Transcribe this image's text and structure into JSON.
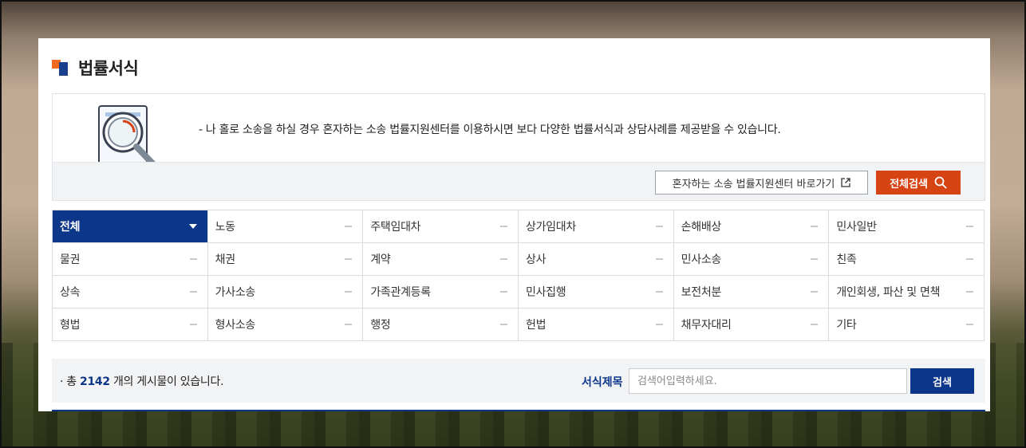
{
  "page": {
    "title": "법률서식"
  },
  "info": {
    "text": "- 나 홀로 소송을 하실 경우 혼자하는 소송 법률지원센터를 이용하시면 보다 다양한 법률서식과 상담사례를 제공받을 수 있습니다.",
    "link_button": "혼자하는 소송 법률지원센터 바로가기",
    "all_search_button": "전체검색"
  },
  "categories": [
    {
      "label": "전체",
      "active": true
    },
    {
      "label": "노동"
    },
    {
      "label": "주택임대차"
    },
    {
      "label": "상가임대차"
    },
    {
      "label": "손해배상"
    },
    {
      "label": "민사일반"
    },
    {
      "label": "물권"
    },
    {
      "label": "채권"
    },
    {
      "label": "계약"
    },
    {
      "label": "상사"
    },
    {
      "label": "민사소송"
    },
    {
      "label": "친족"
    },
    {
      "label": "상속"
    },
    {
      "label": "가사소송"
    },
    {
      "label": "가족관계등록"
    },
    {
      "label": "민사집행"
    },
    {
      "label": "보전처분"
    },
    {
      "label": "개인회생, 파산 및 면책"
    },
    {
      "label": "형법"
    },
    {
      "label": "형사소송"
    },
    {
      "label": "행정"
    },
    {
      "label": "헌법"
    },
    {
      "label": "채무자대리"
    },
    {
      "label": "기타"
    }
  ],
  "search": {
    "count_prefix": "· 총",
    "count": "2142",
    "count_suffix": "개의 게시물이 있습니다.",
    "label": "서식제목",
    "placeholder": "검색어입력하세요.",
    "button": "검색"
  },
  "colors": {
    "accent": "#0c3689",
    "orange": "#d74414",
    "title_orange": "#f26a21"
  },
  "icons": [
    "external-link-icon",
    "search-icon",
    "magnifier-document-illustration",
    "dropdown-caret-icon",
    "collapse-dash-icon"
  ]
}
